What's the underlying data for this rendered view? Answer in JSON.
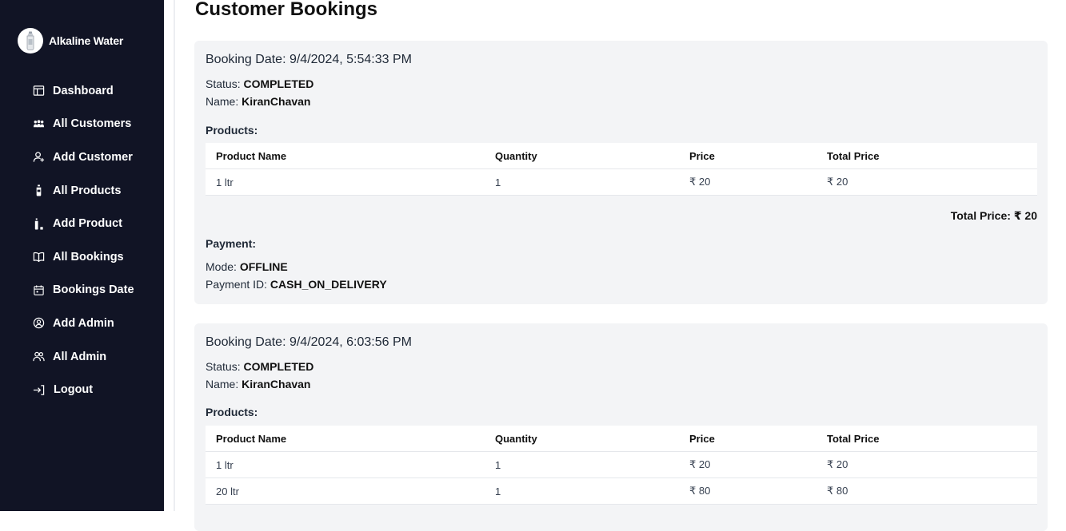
{
  "brand": {
    "name": "Alkaline Water"
  },
  "nav": [
    {
      "label": "Dashboard",
      "icon": "dashboard-icon"
    },
    {
      "label": "All Customers",
      "icon": "users-icon"
    },
    {
      "label": "Add Customer",
      "icon": "user-plus-icon"
    },
    {
      "label": "All Products",
      "icon": "bottle-icon"
    },
    {
      "label": "Add Product",
      "icon": "bottle-plus-icon"
    },
    {
      "label": "All Bookings",
      "icon": "book-icon"
    },
    {
      "label": "Bookings Date",
      "icon": "calendar-icon"
    },
    {
      "label": "Add Admin",
      "icon": "user-circle-icon"
    },
    {
      "label": "All Admin",
      "icon": "group-icon"
    },
    {
      "label": "Logout",
      "icon": "logout-icon"
    }
  ],
  "page": {
    "title": "Customer Bookings"
  },
  "labels": {
    "status": "Status:",
    "name": "Name:",
    "products": "Products:",
    "payment": "Payment:",
    "mode": "Mode:",
    "payment_id": "Payment ID:",
    "total_price": "Total Price:"
  },
  "table_headers": [
    "Product Name",
    "Quantity",
    "Price",
    "Total Price"
  ],
  "bookings": [
    {
      "booking_date": "Booking Date: 9/4/2024, 5:54:33 PM",
      "status": "COMPLETED",
      "name": "KiranChavan",
      "products": [
        {
          "name": "1 ltr",
          "quantity": "1",
          "price": "₹ 20",
          "total": "₹ 20"
        }
      ],
      "total_price": "₹ 20",
      "mode": "OFFLINE",
      "payment_id": "CASH_ON_DELIVERY"
    },
    {
      "booking_date": "Booking Date: 9/4/2024, 6:03:56 PM",
      "status": "COMPLETED",
      "name": "KiranChavan",
      "products": [
        {
          "name": "1 ltr",
          "quantity": "1",
          "price": "₹ 20",
          "total": "₹ 20"
        },
        {
          "name": "20 ltr",
          "quantity": "1",
          "price": "₹ 80",
          "total": "₹ 80"
        }
      ]
    }
  ]
}
